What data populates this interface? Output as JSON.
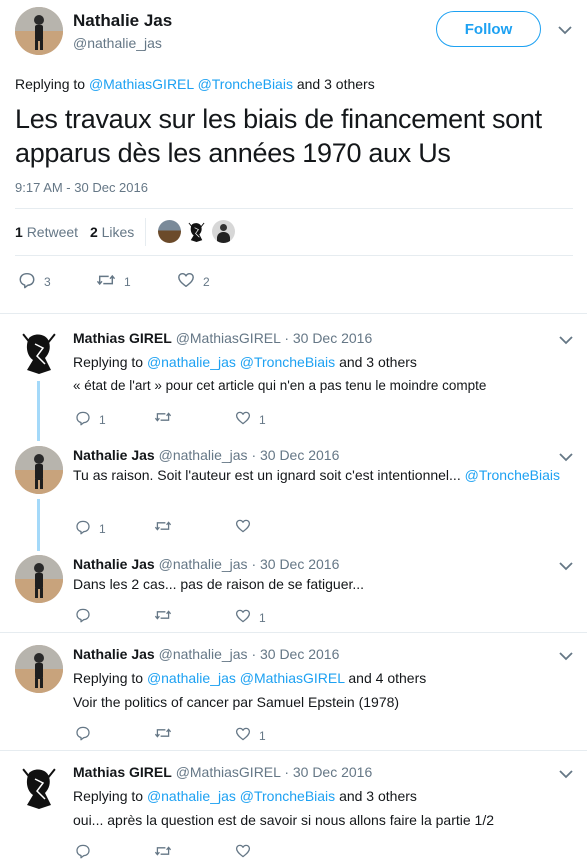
{
  "main_tweet": {
    "author_name": "Nathalie Jas",
    "author_handle": "@nathalie_jas",
    "follow_label": "Follow",
    "replying_prefix": "Replying to",
    "replying_to_1": "@MathiasGIREL",
    "replying_to_2": "@TroncheBiais",
    "replying_suffix": "and 3 others",
    "text_line_1": "Les travaux sur les biais de financement sont",
    "text_line_2": "apparus dès les années 1970 aux Us",
    "timestamp": "9:17 AM - 30 Dec 2016",
    "retweet_count": "1",
    "retweet_label": "Retweet",
    "likes_count": "2",
    "likes_label": "Likes",
    "reply_count": "3",
    "action_retweet_count": "1",
    "action_like_count": "2"
  },
  "replies": [
    {
      "author_name": "Mathias GIREL",
      "author_handle": "@MathiasGIREL",
      "date": "· 30 Dec 2016",
      "replying_prefix": "Replying to",
      "replying_to_1": "@nathalie_jas",
      "replying_to_2": "@TroncheBiais",
      "replying_suffix": "and 3 others",
      "text": "« état de l'art » pour cet article qui n'en a pas tenu le moindre compte",
      "reply_count": "1",
      "retweet_count": "",
      "like_count": "1"
    },
    {
      "author_name": "Nathalie Jas",
      "author_handle": "@nathalie_jas",
      "date": "· 30 Dec 2016",
      "text": "Tu as raison. Soit l'auteur est un ignard soit c'est intentionnel...",
      "text_mention": "@TroncheBiais",
      "reply_count": "1",
      "retweet_count": "",
      "like_count": ""
    },
    {
      "author_name": "Nathalie Jas",
      "author_handle": "@nathalie_jas",
      "date": "· 30 Dec 2016",
      "text": "Dans les 2 cas... pas de raison de se fatiguer...",
      "reply_count": "",
      "retweet_count": "",
      "like_count": "1"
    },
    {
      "author_name": "Nathalie Jas",
      "author_handle": "@nathalie_jas",
      "date": "· 30 Dec 2016",
      "replying_prefix": "Replying to",
      "replying_to_1": "@nathalie_jas",
      "replying_to_2": "@MathiasGIREL",
      "replying_suffix": "and 4 others",
      "text": "Voir the politics of cancer par Samuel Epstein (1978)",
      "reply_count": "",
      "retweet_count": "",
      "like_count": "1"
    },
    {
      "author_name": "Mathias GIREL",
      "author_handle": "@MathiasGIREL",
      "date": "· 30 Dec 2016",
      "replying_prefix": "Replying to",
      "replying_to_1": "@nathalie_jas",
      "replying_to_2": "@TroncheBiais",
      "replying_suffix": "and 3 others",
      "text": "oui... après la question est de savoir si nous allons faire la partie 1/2",
      "reply_count": "",
      "retweet_count": "",
      "like_count": ""
    }
  ],
  "icons": {
    "reply": "reply-icon",
    "retweet": "retweet-icon",
    "like": "heart-icon",
    "more": "chevron-down-icon"
  },
  "colors": {
    "accent": "#1da1f2",
    "secondary_text": "#657786",
    "thread_line": "#a4d9f9",
    "divider": "#e6ecf0"
  }
}
